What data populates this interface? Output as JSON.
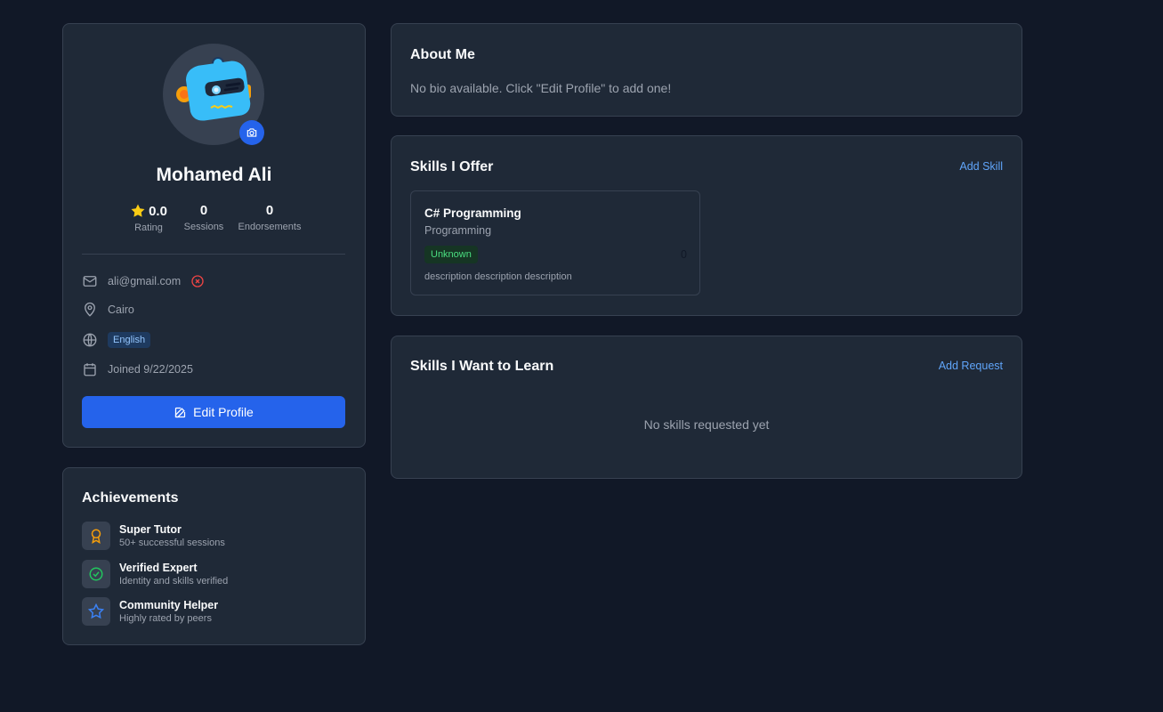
{
  "profile": {
    "name": "Mohamed Ali",
    "stats": [
      {
        "value": "0.0",
        "label": "Rating",
        "icon": "star-icon"
      },
      {
        "value": "0",
        "label": "Sessions"
      },
      {
        "value": "0",
        "label": "Endorsements"
      }
    ],
    "email": "ali@gmail.com",
    "location": "Cairo",
    "language": "English",
    "joined": "Joined 9/22/2025",
    "edit_button": "Edit Profile"
  },
  "achievements": {
    "title": "Achievements",
    "items": [
      {
        "title": "Super Tutor",
        "desc": "50+ successful sessions",
        "icon": "award-icon",
        "color": "#f59e0b"
      },
      {
        "title": "Verified Expert",
        "desc": "Identity and skills verified",
        "icon": "check-circle-icon",
        "color": "#22c55e"
      },
      {
        "title": "Community Helper",
        "desc": "Highly rated by peers",
        "icon": "star-outline-icon",
        "color": "#3b82f6"
      }
    ]
  },
  "about": {
    "title": "About Me",
    "text": "No bio available. Click \"Edit Profile\" to add one!"
  },
  "skills_offer": {
    "title": "Skills I Offer",
    "add_label": "Add Skill",
    "items": [
      {
        "name": "C# Programming",
        "category": "Programming",
        "level": "Unknown",
        "count": "0",
        "description": "description description description"
      }
    ]
  },
  "skills_learn": {
    "title": "Skills I Want to Learn",
    "add_label": "Add Request",
    "empty_text": "No skills requested yet"
  },
  "colors": {
    "background": "#111827",
    "card": "#1f2937",
    "accent": "#2563eb",
    "link": "#60a5fa",
    "error": "#ef4444"
  }
}
